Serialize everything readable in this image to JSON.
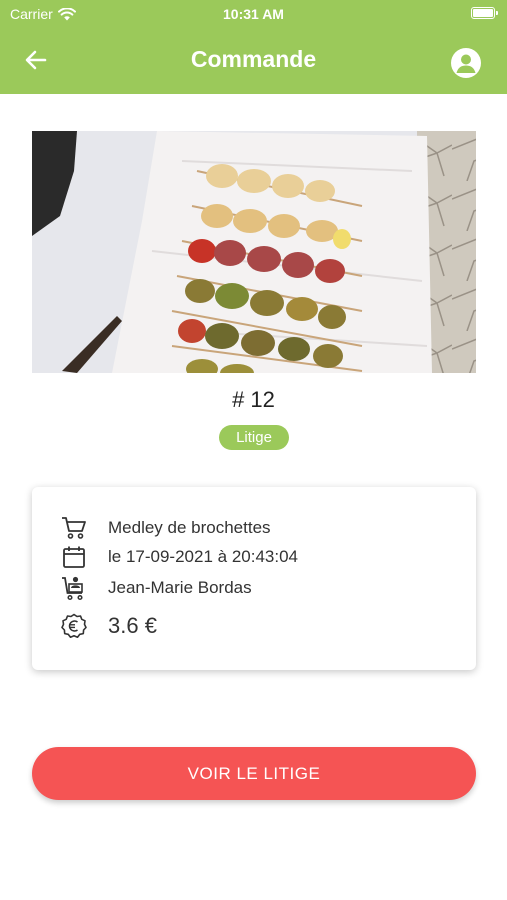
{
  "status_bar": {
    "carrier": "Carrier",
    "time": "10:31 AM"
  },
  "nav": {
    "title": "Commande",
    "back_icon": "arrow-left-icon",
    "profile_icon": "account-circle-icon"
  },
  "order": {
    "number": "# 12",
    "status": "Litige",
    "product": "Medley de brochettes",
    "date": "le 17-09-2021 à 20:43:04",
    "customer": "Jean-Marie Bordas",
    "price": "3.6 €"
  },
  "action": {
    "label": "VOIR LE LITIGE"
  },
  "colors": {
    "header": "#9bc95a",
    "badge": "#9bc95a",
    "button": "#f55454"
  }
}
